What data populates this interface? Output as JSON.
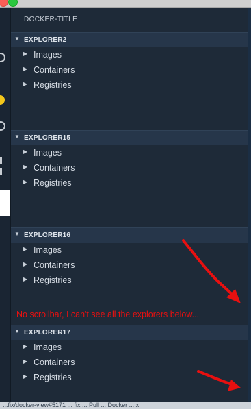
{
  "sidebar": {
    "title": "DOCKER-TITLE",
    "sections": [
      {
        "label": "EXPLORER2",
        "items": [
          "Images",
          "Containers",
          "Registries"
        ]
      },
      {
        "label": "EXPLORER15",
        "items": [
          "Images",
          "Containers",
          "Registries"
        ]
      },
      {
        "label": "EXPLORER16",
        "items": [
          "Images",
          "Containers",
          "Registries"
        ]
      },
      {
        "label": "EXPLORER17",
        "items": [
          "Images",
          "Containers",
          "Registries"
        ]
      }
    ]
  },
  "annotation": {
    "text": "No scrollbar, I can't see all the explorers below...",
    "color": "#e81010"
  },
  "statusbar": {
    "text": "...fix/docker-view#5171 ... fix ... Pull ... Docker ... x"
  },
  "icons": {
    "section_caret": "triangle-down-icon",
    "item_chevron": "triangle-right-icon"
  },
  "colors": {
    "sidebar_bg": "#1e2a38",
    "section_header_bg": "#26364a",
    "annotation": "#e81010"
  }
}
